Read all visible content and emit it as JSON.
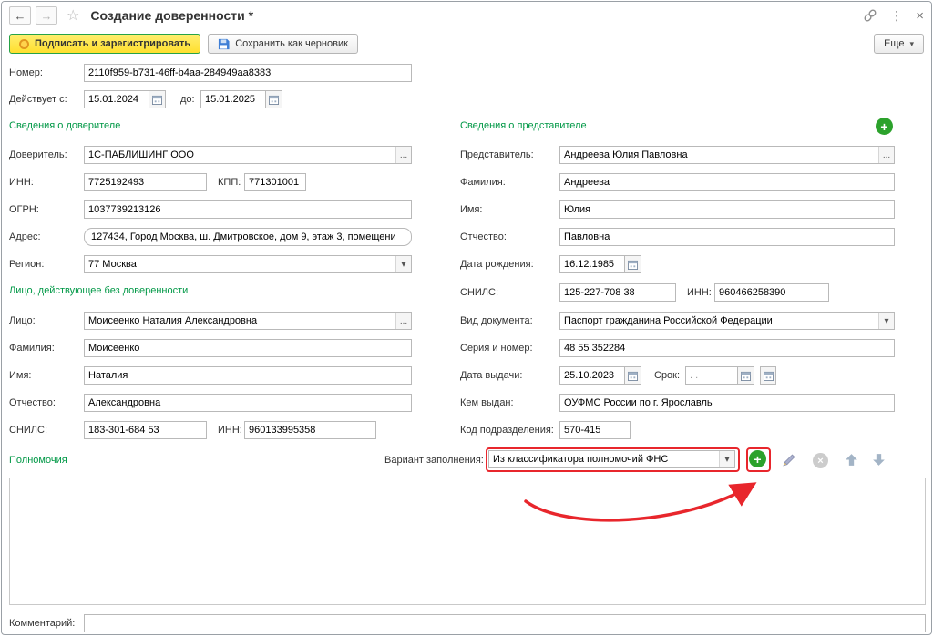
{
  "titlebar": {
    "title": "Создание доверенности *"
  },
  "toolbar": {
    "sign": "Подписать и зарегистрировать",
    "draft": "Сохранить как черновик",
    "more": "Еще"
  },
  "icons": {
    "back": "←",
    "forward": "→",
    "star": "☆",
    "kebab": "⋮",
    "close": "×",
    "ellipsis": "...",
    "dropdown": "▾",
    "plus": "+"
  },
  "top": {
    "number_label": "Номер:",
    "number": "2110f959-b731-46ff-b4aa-284949aa8383",
    "valid_from_label": "Действует с:",
    "valid_from": "15.01.2024",
    "valid_to_label": "до:",
    "valid_to": "15.01.2025"
  },
  "principal": {
    "title": "Сведения о доверителе",
    "entity_label": "Доверитель:",
    "entity": "1С-ПАБЛИШИНГ ООО",
    "inn_label": "ИНН:",
    "inn": "7725192493",
    "kpp_label": "КПП:",
    "kpp": "771301001",
    "ogrn_label": "ОГРН:",
    "ogrn": "1037739213126",
    "address_label": "Адрес:",
    "address": "127434, Город Москва, ш. Дмитровское, дом 9, этаж 3, помещени",
    "region_label": "Регион:",
    "region": "77 Москва"
  },
  "signer": {
    "title": "Лицо, действующее без доверенности",
    "person_label": "Лицо:",
    "person": "Моисеенко Наталия Александровна",
    "surname_label": "Фамилия:",
    "surname": "Моисеенко",
    "name_label": "Имя:",
    "name": "Наталия",
    "patronymic_label": "Отчество:",
    "patronymic": "Александровна",
    "snils_label": "СНИЛС:",
    "snils": "183-301-684 53",
    "inn_label": "ИНН:",
    "inn": "960133995358"
  },
  "representative": {
    "title": "Сведения о представителе",
    "person_label": "Представитель:",
    "person": "Андреева Юлия Павловна",
    "surname_label": "Фамилия:",
    "surname": "Андреева",
    "name_label": "Имя:",
    "name": "Юлия",
    "patronymic_label": "Отчество:",
    "patronymic": "Павловна",
    "birthdate_label": "Дата рождения:",
    "birthdate": "16.12.1985",
    "snils_label": "СНИЛС:",
    "snils": "125-227-708 38",
    "inn_label": "ИНН:",
    "inn": "960466258390",
    "doc_type_label": "Вид документа:",
    "doc_type": "Паспорт гражданина Российской Федерации",
    "series_label": "Серия и номер:",
    "series": "48 55 352284",
    "issue_date_label": "Дата выдачи:",
    "issue_date": "25.10.2023",
    "term_label": "Срок:",
    "term": ".  .",
    "issued_by_label": "Кем выдан:",
    "issued_by": "ОУФМС России по г. Ярославль",
    "division_label": "Код подразделения:",
    "division": "570-415"
  },
  "powers": {
    "title": "Полномочия",
    "variant_label": "Вариант заполнения:",
    "variant": "Из классификатора полномочий ФНС"
  },
  "comment": {
    "label": "Комментарий:",
    "value": ""
  },
  "colors": {
    "section_green": "#009846",
    "highlight_red": "#e8262c",
    "button_yellow": "#ffdf2e"
  }
}
